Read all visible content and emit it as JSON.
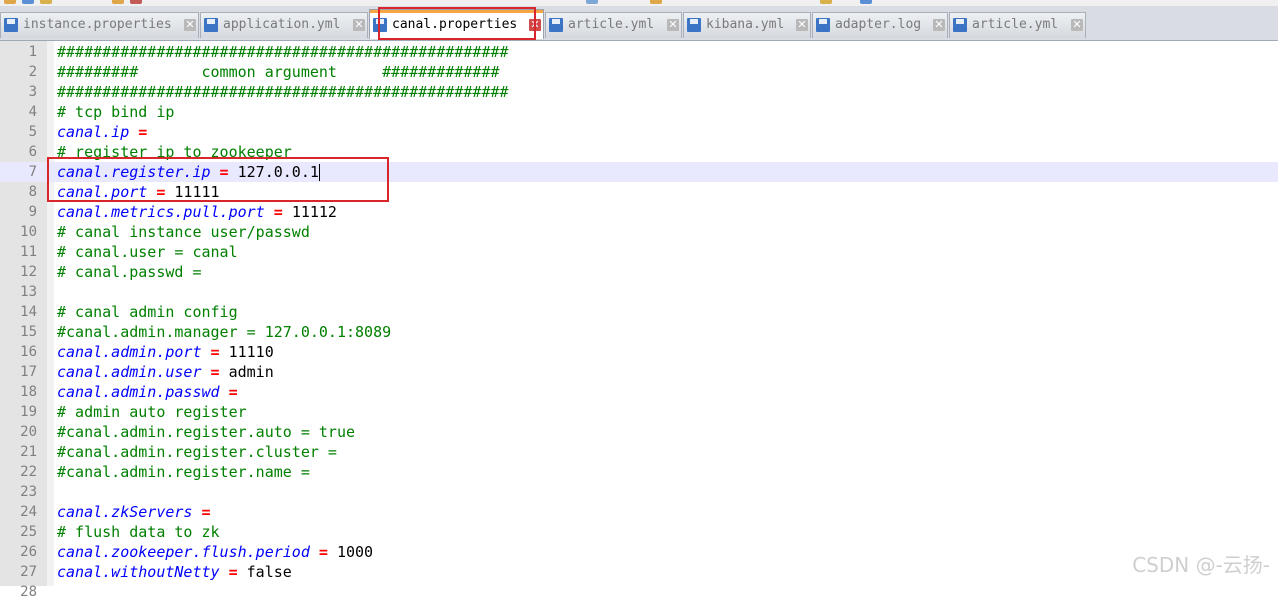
{
  "tabs": [
    {
      "label": "instance.properties",
      "active": false
    },
    {
      "label": "application.yml",
      "active": false
    },
    {
      "label": "canal.properties",
      "active": true
    },
    {
      "label": "article.yml",
      "active": false
    },
    {
      "label": "kibana.yml",
      "active": false
    },
    {
      "label": "adapter.log",
      "active": false
    },
    {
      "label": "article.yml",
      "active": false
    }
  ],
  "editor": {
    "current_line": 7,
    "lines": [
      {
        "n": "1",
        "tokens": [
          {
            "t": "##################################################",
            "c": "c"
          }
        ]
      },
      {
        "n": "2",
        "tokens": [
          {
            "t": "#########       common argument     #############",
            "c": "c"
          }
        ]
      },
      {
        "n": "3",
        "tokens": [
          {
            "t": "##################################################",
            "c": "c"
          }
        ]
      },
      {
        "n": "4",
        "tokens": [
          {
            "t": "# tcp bind ip",
            "c": "c"
          }
        ]
      },
      {
        "n": "5",
        "tokens": [
          {
            "t": "canal.ip",
            "c": "k"
          },
          {
            "t": " = ",
            "c": "e"
          }
        ]
      },
      {
        "n": "6",
        "tokens": [
          {
            "t": "# register ip to zookeeper",
            "c": "c"
          }
        ]
      },
      {
        "n": "7",
        "tokens": [
          {
            "t": "canal.register.ip",
            "c": "k"
          },
          {
            "t": " = ",
            "c": "e"
          },
          {
            "t": "127.0.0.1",
            "c": "v"
          }
        ]
      },
      {
        "n": "8",
        "tokens": [
          {
            "t": "canal.port",
            "c": "k"
          },
          {
            "t": " = ",
            "c": "e"
          },
          {
            "t": "11111",
            "c": "v"
          }
        ]
      },
      {
        "n": "9",
        "tokens": [
          {
            "t": "canal.metrics.pull.port",
            "c": "k"
          },
          {
            "t": " = ",
            "c": "e"
          },
          {
            "t": "11112",
            "c": "v"
          }
        ]
      },
      {
        "n": "10",
        "tokens": [
          {
            "t": "# canal instance user/passwd",
            "c": "c"
          }
        ]
      },
      {
        "n": "11",
        "tokens": [
          {
            "t": "# canal.user = canal",
            "c": "c"
          }
        ]
      },
      {
        "n": "12",
        "tokens": [
          {
            "t": "# canal.passwd = ",
            "c": "c"
          }
        ]
      },
      {
        "n": "13",
        "tokens": []
      },
      {
        "n": "14",
        "tokens": [
          {
            "t": "# canal admin config",
            "c": "c"
          }
        ]
      },
      {
        "n": "15",
        "tokens": [
          {
            "t": "#canal.admin.manager = 127.0.0.1:8089",
            "c": "c"
          }
        ]
      },
      {
        "n": "16",
        "tokens": [
          {
            "t": "canal.admin.port",
            "c": "k"
          },
          {
            "t": " = ",
            "c": "e"
          },
          {
            "t": "11110",
            "c": "v"
          }
        ]
      },
      {
        "n": "17",
        "tokens": [
          {
            "t": "canal.admin.user",
            "c": "k"
          },
          {
            "t": " = ",
            "c": "e"
          },
          {
            "t": "admin",
            "c": "v"
          }
        ]
      },
      {
        "n": "18",
        "tokens": [
          {
            "t": "canal.admin.passwd",
            "c": "k"
          },
          {
            "t": " = ",
            "c": "e"
          }
        ]
      },
      {
        "n": "19",
        "tokens": [
          {
            "t": "# admin auto register",
            "c": "c"
          }
        ]
      },
      {
        "n": "20",
        "tokens": [
          {
            "t": "#canal.admin.register.auto = true",
            "c": "c"
          }
        ]
      },
      {
        "n": "21",
        "tokens": [
          {
            "t": "#canal.admin.register.cluster = ",
            "c": "c"
          }
        ]
      },
      {
        "n": "22",
        "tokens": [
          {
            "t": "#canal.admin.register.name = ",
            "c": "c"
          }
        ]
      },
      {
        "n": "23",
        "tokens": []
      },
      {
        "n": "24",
        "tokens": [
          {
            "t": "canal.zkServers",
            "c": "k"
          },
          {
            "t": " = ",
            "c": "e"
          }
        ]
      },
      {
        "n": "25",
        "tokens": [
          {
            "t": "# flush data to zk",
            "c": "c"
          }
        ]
      },
      {
        "n": "26",
        "tokens": [
          {
            "t": "canal.zookeeper.flush.period",
            "c": "k"
          },
          {
            "t": " = ",
            "c": "e"
          },
          {
            "t": "1000",
            "c": "v"
          }
        ]
      },
      {
        "n": "27",
        "tokens": [
          {
            "t": "canal.withoutNetty",
            "c": "k"
          },
          {
            "t": " = ",
            "c": "e"
          },
          {
            "t": "false",
            "c": "v"
          }
        ]
      },
      {
        "n": "28",
        "tokens": []
      }
    ]
  },
  "watermark": "CSDN @-云扬-"
}
